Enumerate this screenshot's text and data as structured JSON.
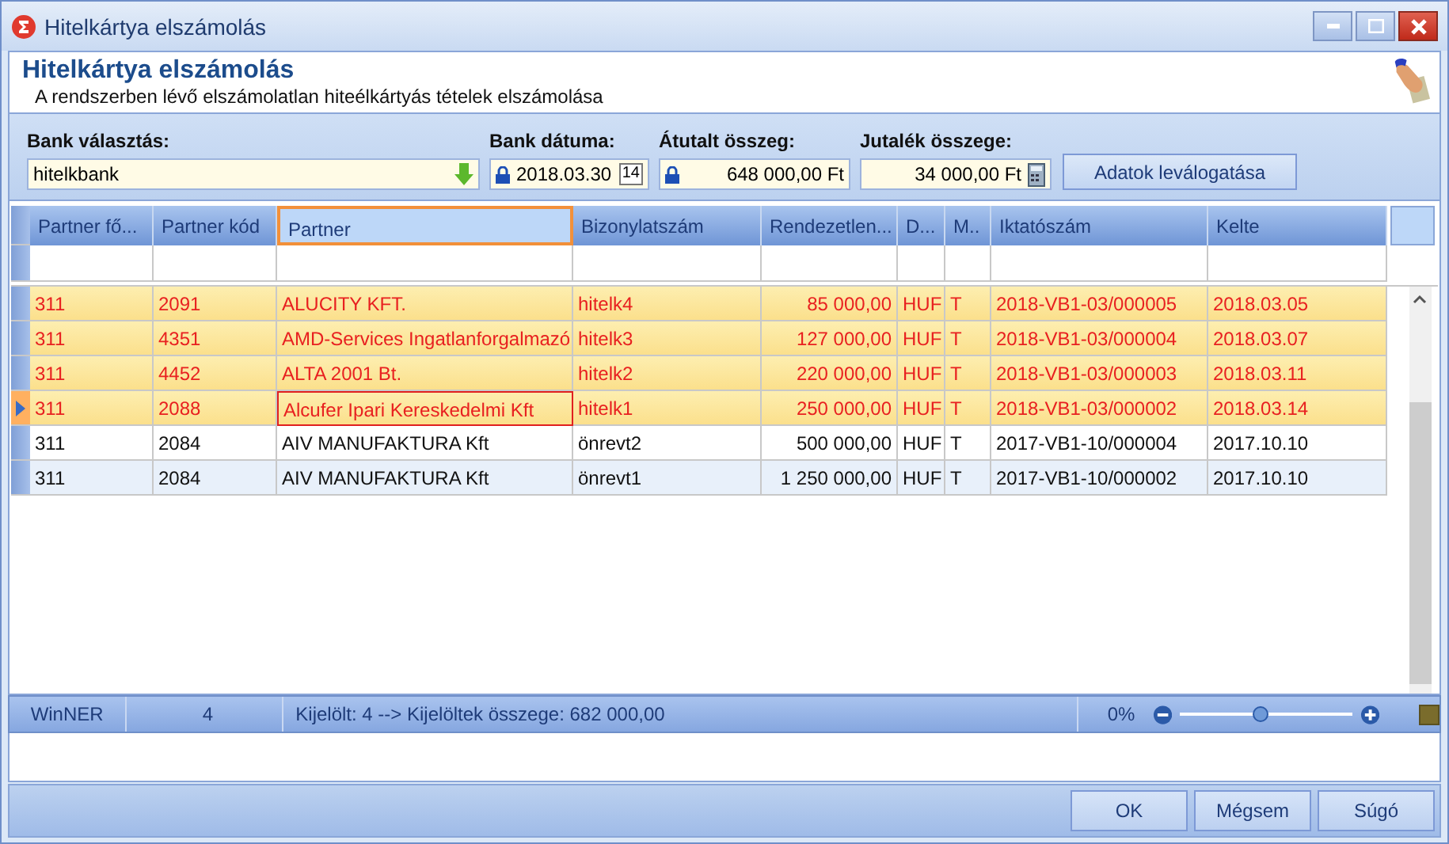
{
  "window": {
    "title": "Hitelkártya elszámolás"
  },
  "header": {
    "title": "Hitelkártya elszámolás",
    "subtitle": "A rendszerben lévő elszámolatlan hiteélkártyás tételek elszámolása"
  },
  "filters": {
    "bank_label": "Bank választás:",
    "bank_value": "hitelkbank",
    "date_label": "Bank dátuma:",
    "date_value": "2018.03.30",
    "calendar_day": "14",
    "transfer_label": "Átutalt összeg:",
    "transfer_value": "648 000,00 Ft",
    "fee_label": "Jutalék összege:",
    "fee_value": "34 000,00 Ft",
    "filter_button": "Adatok leválogatása"
  },
  "table": {
    "columns": [
      {
        "label": "Partner fő...",
        "selected": false
      },
      {
        "label": "Partner kód",
        "selected": false
      },
      {
        "label": "Partner",
        "selected": true
      },
      {
        "label": "Bizonylatszám",
        "selected": false
      },
      {
        "label": "Rendezetlen...",
        "selected": false
      },
      {
        "label": "D...",
        "selected": false
      },
      {
        "label": "M..",
        "selected": false
      },
      {
        "label": "Iktatószám",
        "selected": false
      },
      {
        "label": "Kelte",
        "selected": false
      }
    ],
    "rows": [
      {
        "cells": [
          "311",
          "2091",
          "ALUCITY KFT.",
          "hitelk4",
          "85 000,00",
          "HUF",
          "T",
          "2018-VB1-03/000005",
          "2018.03.05"
        ],
        "selected": true,
        "current": false
      },
      {
        "cells": [
          "311",
          "4351",
          "AMD-Services Ingatlanforgalmazó",
          "hitelk3",
          "127 000,00",
          "HUF",
          "T",
          "2018-VB1-03/000004",
          "2018.03.07"
        ],
        "selected": true,
        "current": false
      },
      {
        "cells": [
          "311",
          "4452",
          "ALTA 2001 Bt.",
          "hitelk2",
          "220 000,00",
          "HUF",
          "T",
          "2018-VB1-03/000003",
          "2018.03.11"
        ],
        "selected": true,
        "current": false
      },
      {
        "cells": [
          "311",
          "2088",
          "Alcufer Ipari Kereskedelmi Kft",
          "hitelk1",
          "250 000,00",
          "HUF",
          "T",
          "2018-VB1-03/000002",
          "2018.03.14"
        ],
        "selected": true,
        "current": true
      },
      {
        "cells": [
          "311",
          "2084",
          "AIV MANUFAKTURA Kft",
          "önrevt2",
          "500 000,00",
          "HUF",
          "T",
          "2017-VB1-10/000004",
          "2017.10.10"
        ],
        "selected": false,
        "current": false
      },
      {
        "cells": [
          "311",
          "2084",
          "AIV MANUFAKTURA Kft",
          "önrevt1",
          "1 250 000,00",
          "HUF",
          "T",
          "2017-VB1-10/000002",
          "2017.10.10"
        ],
        "selected": false,
        "current": false
      }
    ]
  },
  "status_bar": {
    "app": "WinNER",
    "count": "4",
    "summary": "Kijelölt: 4   --> Kijelöltek összege: 682 000,00",
    "zoom": "0%",
    "zoom_level": {
      "level": 0.47
    }
  },
  "buttons": [
    "OK",
    "Mégsem",
    "Súgó"
  ]
}
